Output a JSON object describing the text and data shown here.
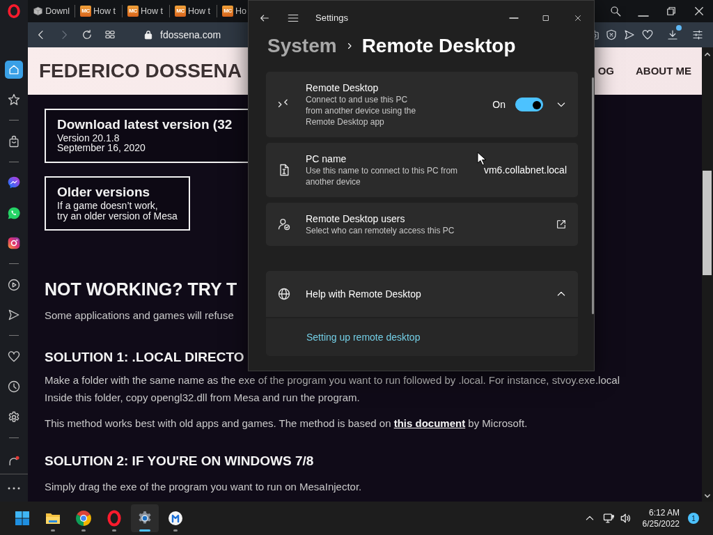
{
  "browser": {
    "tabs": [
      {
        "kind": "box",
        "label": "Downl"
      },
      {
        "kind": "mc",
        "favicon_text": "MC",
        "label": "How t"
      },
      {
        "kind": "mc",
        "favicon_text": "MC",
        "label": "How t"
      },
      {
        "kind": "mc",
        "favicon_text": "MC",
        "label": "How t"
      },
      {
        "kind": "mc",
        "favicon_text": "MC",
        "label": "Ho"
      }
    ],
    "address": "fdossena.com",
    "forward_disabled": true,
    "download_notice": true,
    "sidebar": {
      "groups": [
        [
          {
            "kind": "home",
            "selected": true
          },
          {
            "kind": "star",
            "selected": false
          }
        ],
        [
          {
            "kind": "bag",
            "selected": false
          }
        ],
        [
          {
            "kind": "messenger",
            "selected": false
          },
          {
            "kind": "whatsapp",
            "selected": false
          },
          {
            "kind": "instagram",
            "selected": false
          }
        ],
        [
          {
            "kind": "player",
            "selected": false
          },
          {
            "kind": "send",
            "selected": false
          }
        ],
        [
          {
            "kind": "heart",
            "selected": false
          },
          {
            "kind": "history",
            "selected": false
          },
          {
            "kind": "settings",
            "selected": false
          }
        ],
        [
          {
            "kind": "extension",
            "selected": false
          }
        ]
      ]
    }
  },
  "webpage": {
    "site_title": "FEDERICO DOSSENA",
    "nav": [
      "OG",
      "ABOUT ME"
    ],
    "download_box": {
      "title": "Download latest version (32",
      "lines": [
        "Version 20.1.8",
        "September 16, 2020"
      ]
    },
    "older_box": {
      "title": "Older versions",
      "lines": [
        "If a game doesn’t work,",
        "try an older version of Mesa"
      ]
    },
    "sections": [
      {
        "kind": "h1",
        "text": "NOT WORKING? TRY T"
      },
      {
        "kind": "p",
        "text": "Some applications and games will refuse"
      },
      {
        "kind": "h2",
        "text": "SOLUTION 1: .LOCAL DIRECTO"
      },
      {
        "kind": "lines",
        "lines": [
          "Make a folder with the same name as the exe of the program you want to run followed by .local. For instance, stvoy.exe.local",
          "Inside this folder, copy opengl32.dll from Mesa and run the program."
        ]
      },
      {
        "kind": "p_link",
        "before": "This method works best with old apps and games. The method is based on ",
        "link": "this document",
        "after": " by Microsoft."
      },
      {
        "kind": "h2",
        "text": "SOLUTION 2: IF YOU'RE ON WINDOWS 7/8"
      },
      {
        "kind": "p",
        "text": "Simply drag the exe of the program you want to run on MesaInjector."
      }
    ]
  },
  "settings": {
    "title": "Settings",
    "breadcrumb": [
      "System",
      "Remote Desktop"
    ],
    "cards": [
      {
        "kind": "toggle",
        "title": "Remote Desktop",
        "description_lines": [
          "Connect to and use this PC",
          "from another device using the",
          "Remote Desktop app"
        ],
        "state_label": "On",
        "on": true,
        "expanded": false
      },
      {
        "kind": "value",
        "title": "PC name",
        "description_lines": [
          "Use this name to connect to this PC from",
          "another device"
        ],
        "value": "vm6.collabnet.local"
      },
      {
        "kind": "link",
        "title": "Remote Desktop users",
        "description_lines": [
          "Select who can remotely access this PC"
        ]
      }
    ],
    "help": {
      "title": "Help with Remote Desktop",
      "expanded": true,
      "links": [
        "Setting up remote desktop"
      ]
    }
  },
  "taskbar": {
    "apps": [
      {
        "kind": "start",
        "selected": false,
        "running": false
      },
      {
        "kind": "explorer",
        "selected": false,
        "running": true
      },
      {
        "kind": "chrome",
        "selected": false,
        "running": true
      },
      {
        "kind": "opera",
        "selected": false,
        "running": true
      },
      {
        "kind": "settings",
        "selected": true,
        "running": true
      },
      {
        "kind": "app",
        "selected": false,
        "running": true
      }
    ],
    "time": "6:12 AM",
    "date": "6/25/2022",
    "notification_count": "1"
  }
}
